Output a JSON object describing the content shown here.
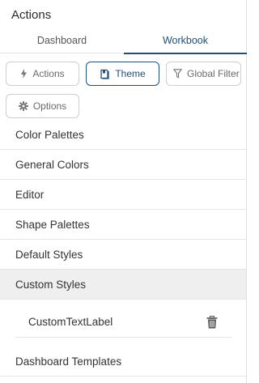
{
  "panel": {
    "title": "Actions"
  },
  "tabs": [
    {
      "label": "Dashboard"
    },
    {
      "label": "Workbook"
    }
  ],
  "buttons": {
    "actions": {
      "label": "Actions",
      "icon": "lightning-icon"
    },
    "theme": {
      "label": "Theme",
      "icon": "theme-icon"
    },
    "global_filter": {
      "label": "Global Filter",
      "icon": "filter-icon"
    },
    "options": {
      "label": "Options",
      "icon": "gear-icon"
    }
  },
  "list": {
    "items": [
      {
        "label": "Color Palettes"
      },
      {
        "label": "General Colors"
      },
      {
        "label": "Editor"
      },
      {
        "label": "Shape Palettes"
      },
      {
        "label": "Default Styles"
      },
      {
        "label": "Custom Styles"
      },
      {
        "label": "Dashboard Templates"
      }
    ],
    "custom_style_entry": {
      "label": "CustomTextLabel",
      "icon": "trash-icon"
    }
  },
  "colors": {
    "accent": "#1f4e79",
    "selected_row": "#efefef",
    "border": "#cfcfcf"
  }
}
